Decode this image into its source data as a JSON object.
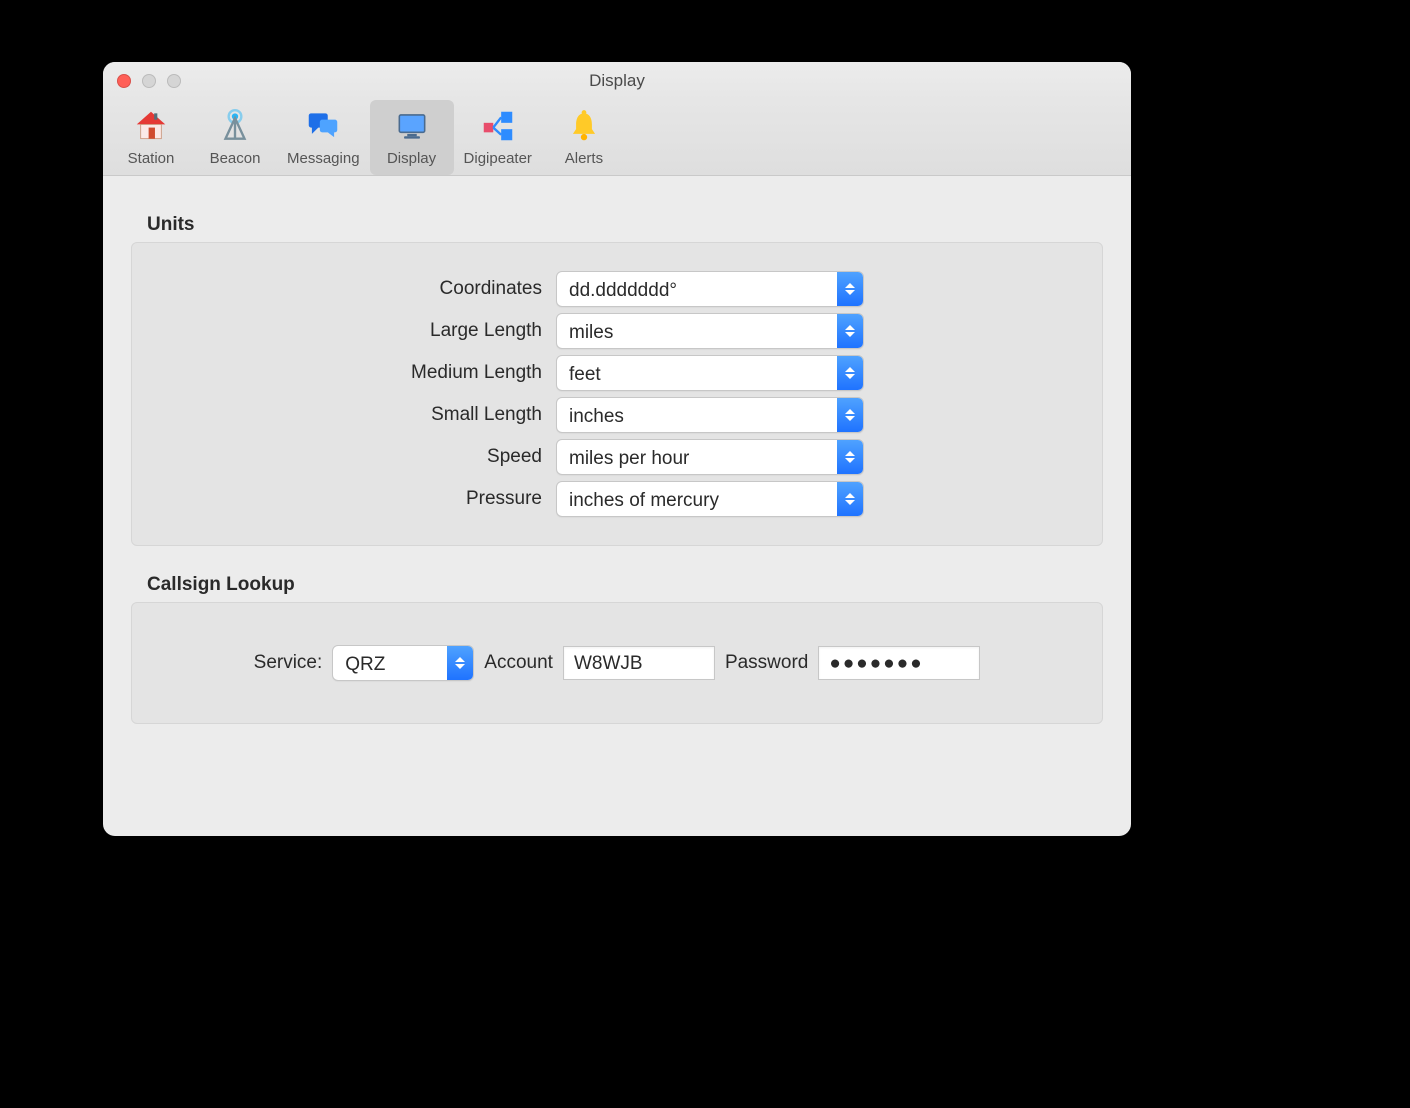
{
  "window": {
    "title": "Display"
  },
  "toolbar": {
    "items": [
      {
        "label": "Station"
      },
      {
        "label": "Beacon"
      },
      {
        "label": "Messaging"
      },
      {
        "label": "Display"
      },
      {
        "label": "Digipeater"
      },
      {
        "label": "Alerts"
      }
    ],
    "active_index": 3
  },
  "units": {
    "section_title": "Units",
    "rows": {
      "coordinates": {
        "label": "Coordinates",
        "value": "dd.ddddddd°"
      },
      "large_length": {
        "label": "Large Length",
        "value": "miles"
      },
      "medium_length": {
        "label": "Medium Length",
        "value": "feet"
      },
      "small_length": {
        "label": "Small Length",
        "value": "inches"
      },
      "speed": {
        "label": "Speed",
        "value": "miles per hour"
      },
      "pressure": {
        "label": "Pressure",
        "value": "inches of mercury"
      }
    }
  },
  "lookup": {
    "section_title": "Callsign Lookup",
    "service_label": "Service:",
    "service_value": "QRZ",
    "account_label": "Account",
    "account_value": "W8WJB",
    "password_label": "Password",
    "password_value": "●●●●●●●"
  }
}
